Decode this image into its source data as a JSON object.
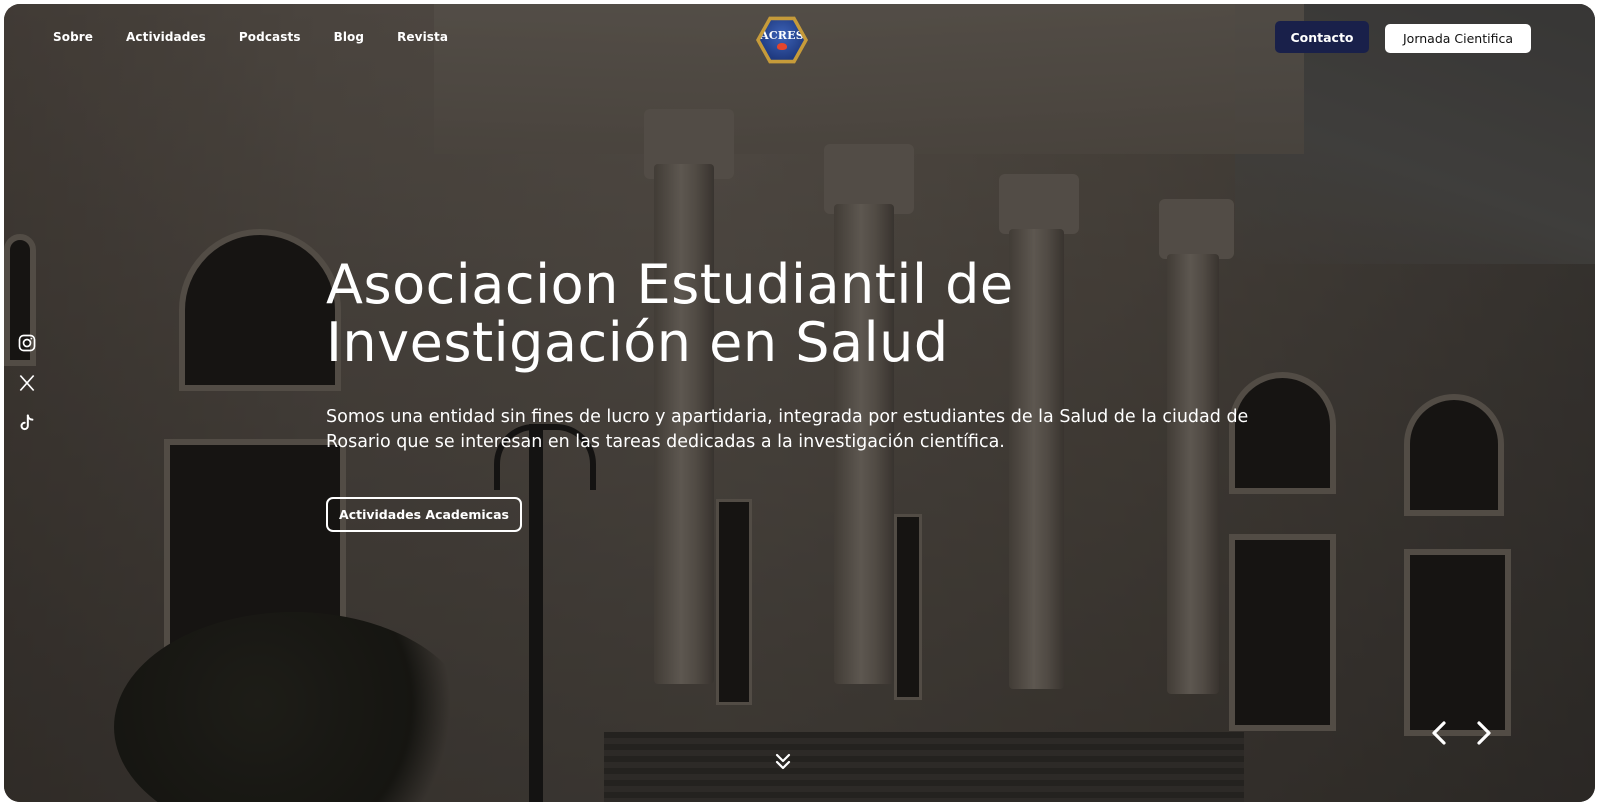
{
  "nav": {
    "items": [
      {
        "label": "Sobre"
      },
      {
        "label": "Actividades"
      },
      {
        "label": "Podcasts"
      },
      {
        "label": "Blog"
      },
      {
        "label": "Revista"
      }
    ]
  },
  "logo": {
    "text": "ACRES",
    "colors": {
      "hex_border": "#c69b3a",
      "inner": "#1f3a80",
      "flame": "#e4452c"
    }
  },
  "header_buttons": {
    "contacto": "Contacto",
    "jornada": "Jornada Cientifica"
  },
  "social": [
    {
      "icon": "instagram-icon"
    },
    {
      "icon": "x-icon"
    },
    {
      "icon": "tiktok-icon"
    }
  ],
  "hero": {
    "title_line1": "Asociacion Estudiantil de",
    "title_line2": "Investigación en Salud",
    "subtitle": "Somos una entidad sin fines de lucro y apartidaria, integrada por estudiantes de la Salud de la ciudad de Rosario que se interesan en las tareas dedicadas a la investigación científica.",
    "cta_label": "Actividades Academicas"
  },
  "slider": {
    "prev_icon": "chevron-left-icon",
    "next_icon": "chevron-right-icon"
  },
  "scroll_icon": "double-chevron-down-icon",
  "colors": {
    "contacto_bg": "#19204a",
    "text": "#ffffff"
  }
}
